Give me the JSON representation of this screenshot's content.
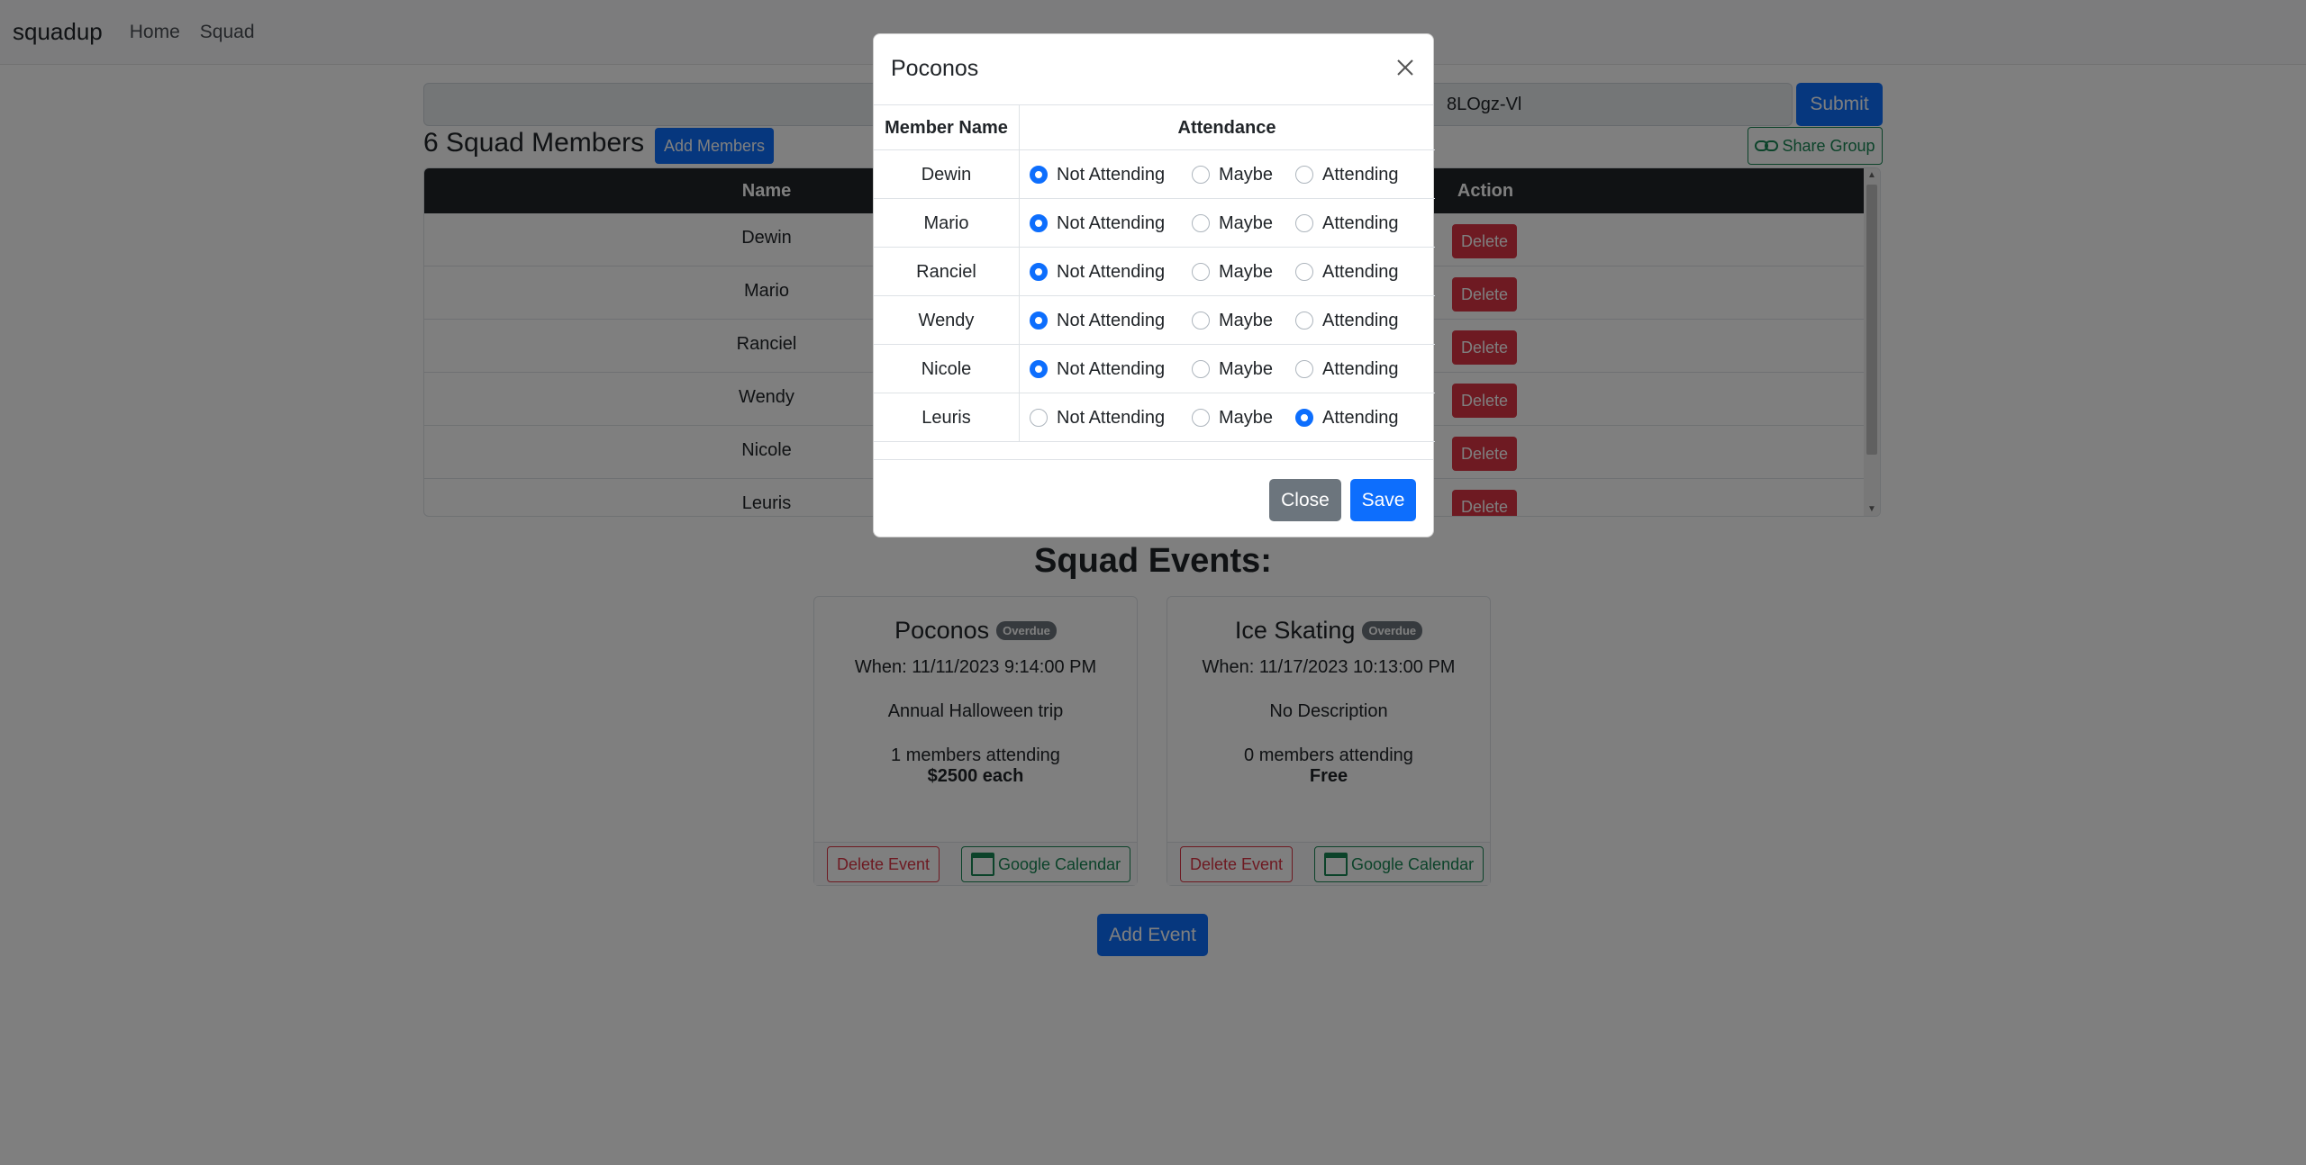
{
  "navbar": {
    "brand": "squadup",
    "links": [
      "Home",
      "Squad"
    ]
  },
  "group": {
    "code": "8LOgz-Vl",
    "submit_label": "Submit",
    "share_label": "Share Group"
  },
  "members": {
    "title": "6 Squad Members",
    "add_label": "Add Members",
    "columns": {
      "name": "Name",
      "action": "Action"
    },
    "delete_label": "Delete",
    "rows": [
      "Dewin",
      "Mario",
      "Ranciel",
      "Wendy",
      "Nicole",
      "Leuris"
    ]
  },
  "events": {
    "title": "Squad Events:",
    "add_label": "Add Event",
    "delete_label": "Delete Event",
    "gcal_label": "Google Calendar",
    "items": [
      {
        "title": "Poconos",
        "badge": "Overdue",
        "when": "When: 11/11/2023 9:14:00 PM",
        "description": "Annual Halloween trip",
        "attending": "1 members attending",
        "cost": "$2500 each"
      },
      {
        "title": "Ice Skating",
        "badge": "Overdue",
        "when": "When: 11/17/2023 10:13:00 PM",
        "description": "No Description",
        "attending": "0 members attending",
        "cost": "Free"
      }
    ]
  },
  "modal": {
    "title": "Poconos",
    "columns": {
      "member": "Member Name",
      "attendance": "Attendance"
    },
    "options": [
      "Not Attending",
      "Maybe",
      "Attending"
    ],
    "rows": [
      {
        "name": "Dewin",
        "selected": "Not Attending"
      },
      {
        "name": "Mario",
        "selected": "Not Attending"
      },
      {
        "name": "Ranciel",
        "selected": "Not Attending"
      },
      {
        "name": "Wendy",
        "selected": "Not Attending"
      },
      {
        "name": "Nicole",
        "selected": "Not Attending"
      },
      {
        "name": "Leuris",
        "selected": "Attending"
      }
    ],
    "close_label": "Close",
    "save_label": "Save"
  },
  "colors": {
    "primary": "#0d6efd",
    "danger": "#dc3545",
    "success": "#198754",
    "secondary": "#6c757d"
  }
}
